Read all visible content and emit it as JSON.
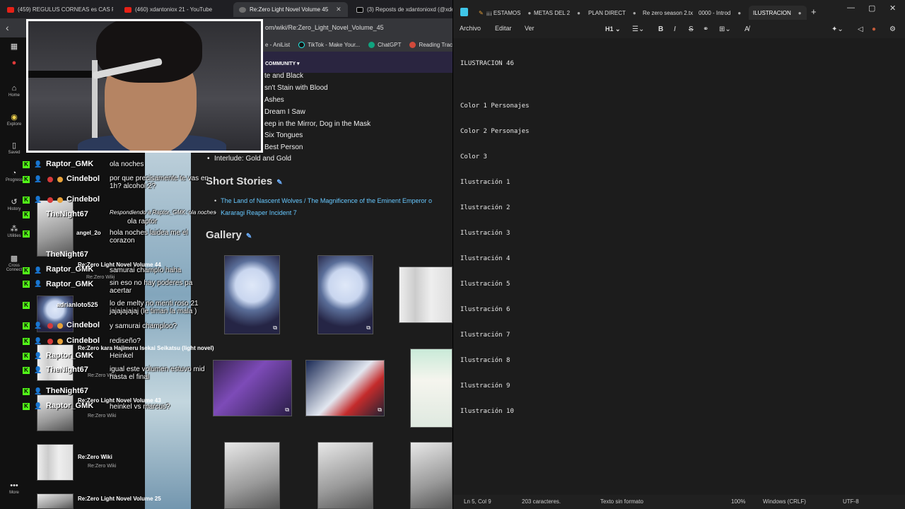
{
  "browser": {
    "tabs": [
      {
        "label": "(459) REGULUS CORNEAS es CAS F"
      },
      {
        "label": "(460) xdantoniox 21 - YouTube"
      },
      {
        "label": "Re:Zero Light Novel Volume 45"
      },
      {
        "label": "(3) Reposts de xdantonioxd (@xde"
      }
    ],
    "url": "om/wiki/Re:Zero_Light_Novel_Volume_45",
    "bookmarks": [
      "e - AniList",
      "TikTok - Make Your...",
      "ChatGPT",
      "Reading Trac"
    ],
    "sidebar": [
      "Home",
      "Explore",
      "Saved",
      "Progress",
      "History",
      "Utilities",
      "Cross Connect",
      "More"
    ]
  },
  "wiki": {
    "community_label": "COMMUNITY",
    "chapters": [
      "te and Black",
      "sn't Stain with Blood",
      "Ashes",
      "Dream I Saw",
      "eep in the Mirror, Dog in the Mask",
      "Six Tongues",
      "Best Person"
    ],
    "interlude": "Interlude: Gold and Gold",
    "short_stories_heading": "Short Stories",
    "short_stories": [
      "The Land of Nascent Wolves / The Magnificence of the Eminent Emperor o",
      "Kararagi Reaper Incident 7"
    ],
    "gallery_heading": "Gallery"
  },
  "chat": [
    {
      "user": "Raptor_GMK",
      "text": "ola noches"
    },
    {
      "user": "Cindebol",
      "text": "por que precisamente te vas en 1h? alcohol 2?"
    },
    {
      "user": "Cindebol",
      "text": "Respondiendo a Raptor_GMK: ola noches"
    },
    {
      "user": "TheNight67",
      "text": "ola raptor"
    },
    {
      "user": "angel_2o",
      "text": "hola noches laidea me el corazon"
    },
    {
      "user": "TheNight67",
      "text": ""
    },
    {
      "user": "Raptor_GMK",
      "text": "samurai champlo haha"
    },
    {
      "user": "Raptor_GMK",
      "text": "sin eso no hay poderes pa acertar"
    },
    {
      "user": "adrianloto525",
      "text": "lo de melty no menti roso 21 jajajajajaj (le timan la mala )"
    },
    {
      "user": "Cindebol",
      "text": "y samurai champloo?"
    },
    {
      "user": "Cindebol",
      "text": "rediseño?"
    },
    {
      "user": "Raptor_GMK",
      "text": "Heinkel"
    },
    {
      "user": "TheNight67",
      "text": "igual este volumen estuvo mid hasta el final"
    },
    {
      "user": "TheNight67",
      "text": ""
    },
    {
      "user": "Raptor_GMK",
      "text": "heinkel vs marcus?"
    }
  ],
  "chat_overlay_wiki_items": [
    {
      "title": "Re:Zero Light Novel Volume 44",
      "sub": "Re:Zero Wiki"
    },
    {
      "title": "Re:Zero kara Hajimeru Isekai Seikatsu (light novel)",
      "sub": "Re:Zero Wiki"
    },
    {
      "title": "Re:Zero Light Novel Volume 43",
      "sub": "Re:Zero Wiki"
    },
    {
      "title": "Re:Zero Wiki",
      "sub": "Re:Zero Wiki"
    },
    {
      "title": "Re:Zero Light Novel Volume 25",
      "sub": ""
    }
  ],
  "notepad": {
    "tabs": [
      {
        "label": "¡¡¡ ESTAMOS"
      },
      {
        "label": "METAS DEL 2"
      },
      {
        "label": "PLAN DIRECT"
      },
      {
        "label": "Re zero season 2.tx"
      },
      {
        "label": "0000 - Introd"
      },
      {
        "label": "ILUSTRACION"
      }
    ],
    "menu": [
      "Archivo",
      "Editar",
      "Ver"
    ],
    "heading_btn": "H1",
    "lines": [
      "ILUSTRACION 46",
      "",
      "Color 1 Personajes",
      "Color 2 Personajes",
      "Color 3",
      "Ilustración 1",
      "Ilustración 2",
      "Ilustración 3",
      "Ilustración 4",
      "Ilustración 5",
      "Ilustración 6",
      "Ilustración 7",
      "Ilustración 8",
      "Ilustración 9",
      "Ilustración 10"
    ],
    "status": {
      "position": "Ln 5, Col 9",
      "chars": "203 caracteres.",
      "format": "Texto sin formato",
      "zoom": "100%",
      "eol": "Windows (CRLF)",
      "encoding": "UTF-8"
    }
  }
}
